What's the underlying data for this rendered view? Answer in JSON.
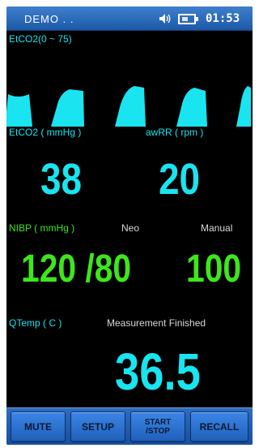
{
  "status_bar": {
    "mode": "DEMO . .",
    "time": "01:53",
    "battery_level": 0.5,
    "icons": [
      "speaker-icon",
      "battery-icon"
    ]
  },
  "etco2_wave": {
    "label": "EtCO2(0 ~ 75)"
  },
  "etco2": {
    "label": "EtCO2 ( mmHg )",
    "value": "38"
  },
  "awrr": {
    "label": "awRR ( rpm )",
    "value": "20"
  },
  "nibp": {
    "label": "NIBP ( mmHg )",
    "patient_type": "Neo",
    "mode": "Manual",
    "value": "120 /80",
    "pulse": "100"
  },
  "qtemp": {
    "label": "QTemp ( C )",
    "status": "Measurement Finished",
    "value": "36.5"
  },
  "buttons": {
    "mute": "MUTE",
    "setup": "SETUP",
    "start_line1": "START",
    "start_line2": "/STOP",
    "recall": "RECALL"
  },
  "colors": {
    "etco2": "#19e4f0",
    "nibp": "#3ee61c",
    "temp": "#19e4f0",
    "topbar": "#1c5aa8"
  }
}
